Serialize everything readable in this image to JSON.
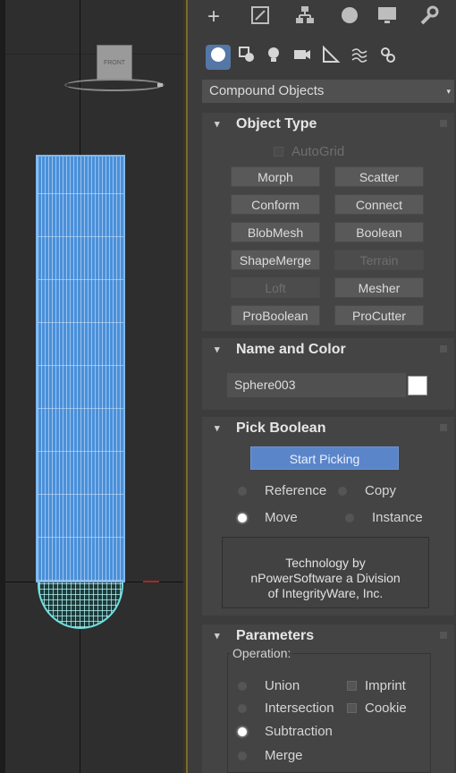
{
  "viewport": {
    "viewcube_label": "FRONT"
  },
  "panel": {
    "top_tabs": [
      "create-icon",
      "modify-icon",
      "hierarchy-icon",
      "motion-icon",
      "display-icon",
      "utilities-icon"
    ],
    "sub_tabs": [
      "geometry-icon",
      "shapes-icon",
      "lights-icon",
      "cameras-icon",
      "helpers-icon",
      "spacewarps-icon",
      "systems-icon"
    ],
    "category": "Compound Objects",
    "object_type": {
      "title": "Object Type",
      "autogrid": "AutoGrid",
      "buttons": [
        {
          "label": "Morph",
          "enabled": true
        },
        {
          "label": "Scatter",
          "enabled": true
        },
        {
          "label": "Conform",
          "enabled": true
        },
        {
          "label": "Connect",
          "enabled": true
        },
        {
          "label": "BlobMesh",
          "enabled": true
        },
        {
          "label": "Boolean",
          "enabled": true
        },
        {
          "label": "ShapeMerge",
          "enabled": true
        },
        {
          "label": "Terrain",
          "enabled": false
        },
        {
          "label": "Loft",
          "enabled": false
        },
        {
          "label": "Mesher",
          "enabled": true
        },
        {
          "label": "ProBoolean",
          "enabled": true
        },
        {
          "label": "ProCutter",
          "enabled": true
        }
      ]
    },
    "name_color": {
      "title": "Name and Color",
      "name_value": "Sphere003",
      "swatch_color": "#ffffff"
    },
    "pick_boolean": {
      "title": "Pick Boolean",
      "start_picking": "Start Picking",
      "reference": "Reference",
      "copy": "Copy",
      "move": "Move",
      "instance": "Instance",
      "tech_line1": "Technology by",
      "tech_line2": "nPowerSoftware a Division",
      "tech_line3": "of IntegrityWare, Inc."
    },
    "parameters": {
      "title": "Parameters",
      "operation_label": "Operation:",
      "union": "Union",
      "intersection": "Intersection",
      "subtraction": "Subtraction",
      "merge": "Merge",
      "imprint": "Imprint",
      "cookie": "Cookie"
    }
  },
  "colors": {
    "accent_blue": "#5a85c9",
    "mesh_blue": "#4a90d9",
    "mesh_cyan": "#6fe0e0"
  }
}
